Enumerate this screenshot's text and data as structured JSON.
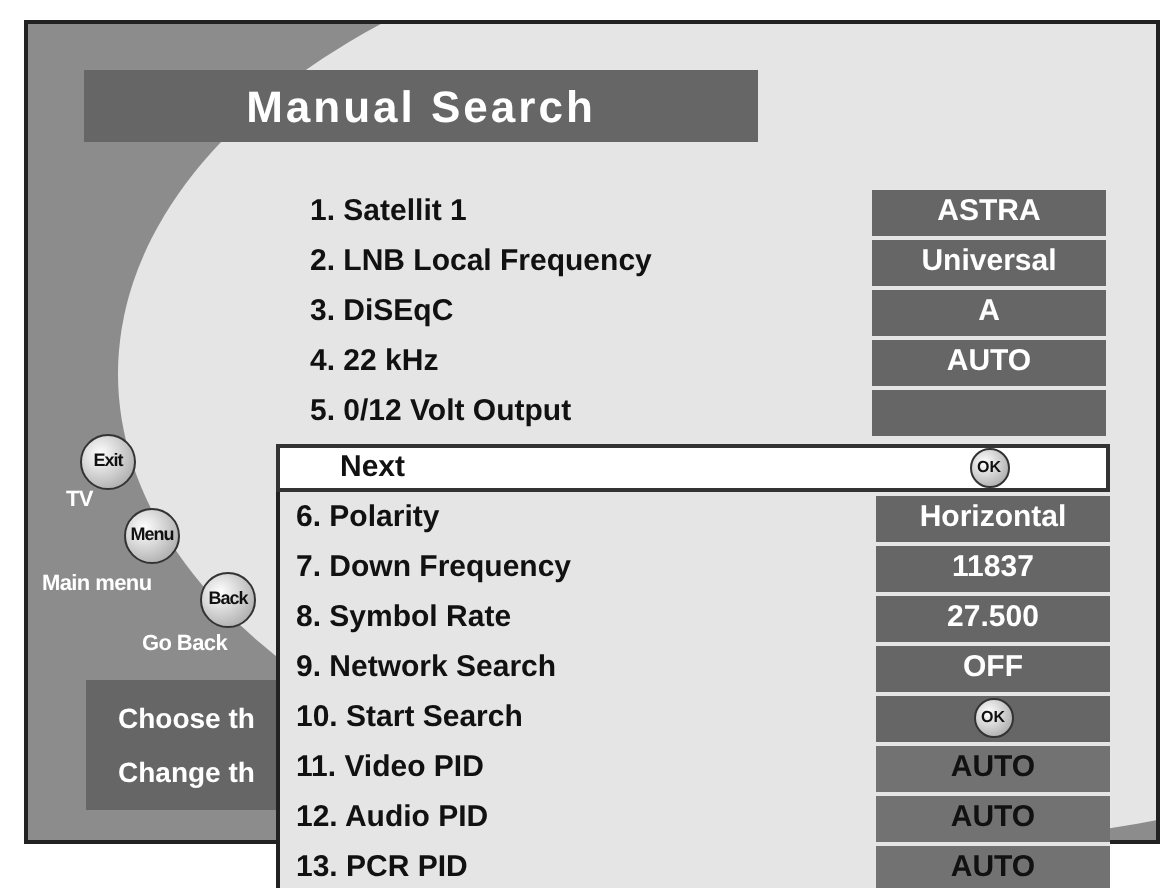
{
  "title": "Manual Search",
  "settings": [
    {
      "label": "1. Satellit 1",
      "kind": "value",
      "value": "ASTRA"
    },
    {
      "label": "2. LNB Local Frequency",
      "kind": "value",
      "value": "Universal"
    },
    {
      "label": "3. DiSEqC",
      "kind": "value",
      "value": "A"
    },
    {
      "label": "4. 22 kHz",
      "kind": "value",
      "value": "AUTO"
    },
    {
      "label": "5. 0/12 Volt Output",
      "kind": "empty"
    }
  ],
  "popup": [
    {
      "label": "Next",
      "kind": "ok",
      "value": "OK",
      "selected": true,
      "disabled": false
    },
    {
      "label": "6. Polarity",
      "kind": "value",
      "value": "Horizontal",
      "selected": false,
      "disabled": false
    },
    {
      "label": "7. Down Frequency",
      "kind": "value",
      "value": "11837",
      "selected": false,
      "disabled": false
    },
    {
      "label": "8. Symbol Rate",
      "kind": "value",
      "value": "27.500",
      "selected": false,
      "disabled": false
    },
    {
      "label": "9. Network Search",
      "kind": "value",
      "value": "OFF",
      "selected": false,
      "disabled": false
    },
    {
      "label": "10. Start Search",
      "kind": "ok",
      "value": "OK",
      "selected": false,
      "disabled": false
    },
    {
      "label": "11. Video PID",
      "kind": "value",
      "value": "AUTO",
      "selected": false,
      "disabled": true
    },
    {
      "label": "12. Audio PID",
      "kind": "value",
      "value": "AUTO",
      "selected": false,
      "disabled": true
    },
    {
      "label": "13. PCR PID",
      "kind": "value",
      "value": "AUTO",
      "selected": false,
      "disabled": true
    }
  ],
  "remote_keys": [
    {
      "key": "Exit",
      "caption": "TV"
    },
    {
      "key": "Menu",
      "caption": "Main menu"
    },
    {
      "key": "Back",
      "caption": "Go Back"
    }
  ],
  "help_lines": [
    "Choose th",
    "Change th"
  ]
}
